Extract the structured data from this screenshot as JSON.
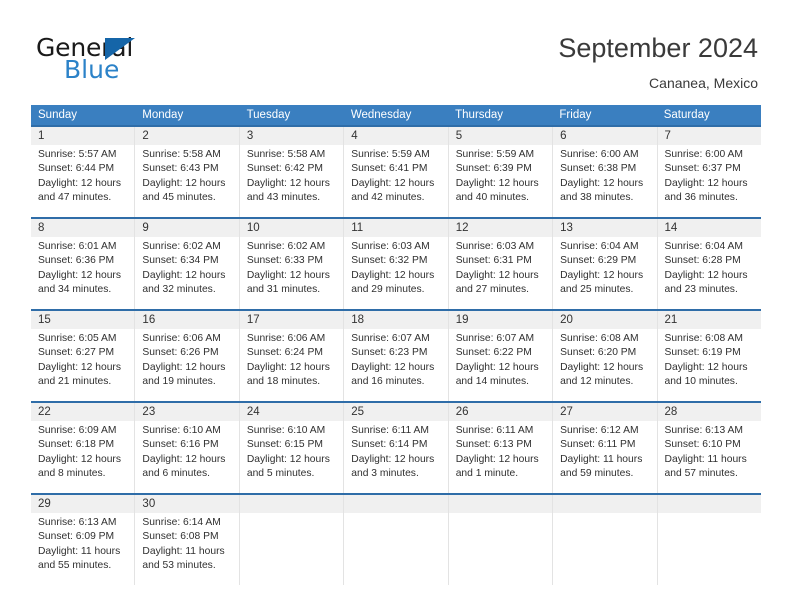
{
  "brand": {
    "name_dark": "General",
    "name_blue": "Blue",
    "accent_blue": "#2b82c8",
    "triangle_blue": "#1565a8"
  },
  "header": {
    "title": "September 2024",
    "location": "Cananea, Mexico",
    "header_bg": "#3a7fc0",
    "row_divider": "#2f6da8",
    "daynum_bg": "#f0f0f0"
  },
  "weekdays": [
    "Sunday",
    "Monday",
    "Tuesday",
    "Wednesday",
    "Thursday",
    "Friday",
    "Saturday"
  ],
  "labels": {
    "sunrise_prefix": "Sunrise:",
    "sunset_prefix": "Sunset:",
    "daylight_prefix": "Daylight:"
  },
  "weeks": [
    {
      "days": [
        {
          "num": "1",
          "sunrise": "Sunrise: 5:57 AM",
          "sunset": "Sunset: 6:44 PM",
          "daylight1": "Daylight: 12 hours",
          "daylight2": "and 47 minutes."
        },
        {
          "num": "2",
          "sunrise": "Sunrise: 5:58 AM",
          "sunset": "Sunset: 6:43 PM",
          "daylight1": "Daylight: 12 hours",
          "daylight2": "and 45 minutes."
        },
        {
          "num": "3",
          "sunrise": "Sunrise: 5:58 AM",
          "sunset": "Sunset: 6:42 PM",
          "daylight1": "Daylight: 12 hours",
          "daylight2": "and 43 minutes."
        },
        {
          "num": "4",
          "sunrise": "Sunrise: 5:59 AM",
          "sunset": "Sunset: 6:41 PM",
          "daylight1": "Daylight: 12 hours",
          "daylight2": "and 42 minutes."
        },
        {
          "num": "5",
          "sunrise": "Sunrise: 5:59 AM",
          "sunset": "Sunset: 6:39 PM",
          "daylight1": "Daylight: 12 hours",
          "daylight2": "and 40 minutes."
        },
        {
          "num": "6",
          "sunrise": "Sunrise: 6:00 AM",
          "sunset": "Sunset: 6:38 PM",
          "daylight1": "Daylight: 12 hours",
          "daylight2": "and 38 minutes."
        },
        {
          "num": "7",
          "sunrise": "Sunrise: 6:00 AM",
          "sunset": "Sunset: 6:37 PM",
          "daylight1": "Daylight: 12 hours",
          "daylight2": "and 36 minutes."
        }
      ]
    },
    {
      "days": [
        {
          "num": "8",
          "sunrise": "Sunrise: 6:01 AM",
          "sunset": "Sunset: 6:36 PM",
          "daylight1": "Daylight: 12 hours",
          "daylight2": "and 34 minutes."
        },
        {
          "num": "9",
          "sunrise": "Sunrise: 6:02 AM",
          "sunset": "Sunset: 6:34 PM",
          "daylight1": "Daylight: 12 hours",
          "daylight2": "and 32 minutes."
        },
        {
          "num": "10",
          "sunrise": "Sunrise: 6:02 AM",
          "sunset": "Sunset: 6:33 PM",
          "daylight1": "Daylight: 12 hours",
          "daylight2": "and 31 minutes."
        },
        {
          "num": "11",
          "sunrise": "Sunrise: 6:03 AM",
          "sunset": "Sunset: 6:32 PM",
          "daylight1": "Daylight: 12 hours",
          "daylight2": "and 29 minutes."
        },
        {
          "num": "12",
          "sunrise": "Sunrise: 6:03 AM",
          "sunset": "Sunset: 6:31 PM",
          "daylight1": "Daylight: 12 hours",
          "daylight2": "and 27 minutes."
        },
        {
          "num": "13",
          "sunrise": "Sunrise: 6:04 AM",
          "sunset": "Sunset: 6:29 PM",
          "daylight1": "Daylight: 12 hours",
          "daylight2": "and 25 minutes."
        },
        {
          "num": "14",
          "sunrise": "Sunrise: 6:04 AM",
          "sunset": "Sunset: 6:28 PM",
          "daylight1": "Daylight: 12 hours",
          "daylight2": "and 23 minutes."
        }
      ]
    },
    {
      "days": [
        {
          "num": "15",
          "sunrise": "Sunrise: 6:05 AM",
          "sunset": "Sunset: 6:27 PM",
          "daylight1": "Daylight: 12 hours",
          "daylight2": "and 21 minutes."
        },
        {
          "num": "16",
          "sunrise": "Sunrise: 6:06 AM",
          "sunset": "Sunset: 6:26 PM",
          "daylight1": "Daylight: 12 hours",
          "daylight2": "and 19 minutes."
        },
        {
          "num": "17",
          "sunrise": "Sunrise: 6:06 AM",
          "sunset": "Sunset: 6:24 PM",
          "daylight1": "Daylight: 12 hours",
          "daylight2": "and 18 minutes."
        },
        {
          "num": "18",
          "sunrise": "Sunrise: 6:07 AM",
          "sunset": "Sunset: 6:23 PM",
          "daylight1": "Daylight: 12 hours",
          "daylight2": "and 16 minutes."
        },
        {
          "num": "19",
          "sunrise": "Sunrise: 6:07 AM",
          "sunset": "Sunset: 6:22 PM",
          "daylight1": "Daylight: 12 hours",
          "daylight2": "and 14 minutes."
        },
        {
          "num": "20",
          "sunrise": "Sunrise: 6:08 AM",
          "sunset": "Sunset: 6:20 PM",
          "daylight1": "Daylight: 12 hours",
          "daylight2": "and 12 minutes."
        },
        {
          "num": "21",
          "sunrise": "Sunrise: 6:08 AM",
          "sunset": "Sunset: 6:19 PM",
          "daylight1": "Daylight: 12 hours",
          "daylight2": "and 10 minutes."
        }
      ]
    },
    {
      "days": [
        {
          "num": "22",
          "sunrise": "Sunrise: 6:09 AM",
          "sunset": "Sunset: 6:18 PM",
          "daylight1": "Daylight: 12 hours",
          "daylight2": "and 8 minutes."
        },
        {
          "num": "23",
          "sunrise": "Sunrise: 6:10 AM",
          "sunset": "Sunset: 6:16 PM",
          "daylight1": "Daylight: 12 hours",
          "daylight2": "and 6 minutes."
        },
        {
          "num": "24",
          "sunrise": "Sunrise: 6:10 AM",
          "sunset": "Sunset: 6:15 PM",
          "daylight1": "Daylight: 12 hours",
          "daylight2": "and 5 minutes."
        },
        {
          "num": "25",
          "sunrise": "Sunrise: 6:11 AM",
          "sunset": "Sunset: 6:14 PM",
          "daylight1": "Daylight: 12 hours",
          "daylight2": "and 3 minutes."
        },
        {
          "num": "26",
          "sunrise": "Sunrise: 6:11 AM",
          "sunset": "Sunset: 6:13 PM",
          "daylight1": "Daylight: 12 hours",
          "daylight2": "and 1 minute."
        },
        {
          "num": "27",
          "sunrise": "Sunrise: 6:12 AM",
          "sunset": "Sunset: 6:11 PM",
          "daylight1": "Daylight: 11 hours",
          "daylight2": "and 59 minutes."
        },
        {
          "num": "28",
          "sunrise": "Sunrise: 6:13 AM",
          "sunset": "Sunset: 6:10 PM",
          "daylight1": "Daylight: 11 hours",
          "daylight2": "and 57 minutes."
        }
      ]
    },
    {
      "days": [
        {
          "num": "29",
          "sunrise": "Sunrise: 6:13 AM",
          "sunset": "Sunset: 6:09 PM",
          "daylight1": "Daylight: 11 hours",
          "daylight2": "and 55 minutes."
        },
        {
          "num": "30",
          "sunrise": "Sunrise: 6:14 AM",
          "sunset": "Sunset: 6:08 PM",
          "daylight1": "Daylight: 11 hours",
          "daylight2": "and 53 minutes."
        },
        {
          "num": "",
          "sunrise": "",
          "sunset": "",
          "daylight1": "",
          "daylight2": ""
        },
        {
          "num": "",
          "sunrise": "",
          "sunset": "",
          "daylight1": "",
          "daylight2": ""
        },
        {
          "num": "",
          "sunrise": "",
          "sunset": "",
          "daylight1": "",
          "daylight2": ""
        },
        {
          "num": "",
          "sunrise": "",
          "sunset": "",
          "daylight1": "",
          "daylight2": ""
        },
        {
          "num": "",
          "sunrise": "",
          "sunset": "",
          "daylight1": "",
          "daylight2": ""
        }
      ]
    }
  ]
}
